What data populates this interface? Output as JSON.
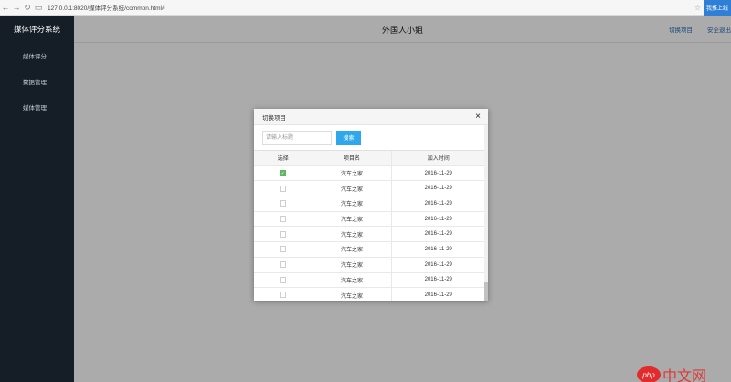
{
  "browser": {
    "url": "127.0.0.1:8020/媒体评分系统/common.html#",
    "badge": "我推上线"
  },
  "sidebar": {
    "brand": "媒体评分系统",
    "items": [
      {
        "label": "媒体评分"
      },
      {
        "label": "数据管理"
      },
      {
        "label": "媒体管理"
      }
    ]
  },
  "header": {
    "title": "外国人小姐",
    "links": [
      {
        "label": "切换项目"
      },
      {
        "label": "安全退出"
      }
    ]
  },
  "modal": {
    "title": "切换项目",
    "close": "×",
    "search_placeholder": "请输入标题",
    "search_button": "搜索",
    "columns": [
      "选择",
      "项目名",
      "加入时间"
    ],
    "rows": [
      {
        "checked": true,
        "name": "汽车之家",
        "date": "2016-11-29"
      },
      {
        "checked": false,
        "name": "汽车之家",
        "date": "2016-11-29"
      },
      {
        "checked": false,
        "name": "汽车之家",
        "date": "2016-11-29"
      },
      {
        "checked": false,
        "name": "汽车之家",
        "date": "2016-11-29"
      },
      {
        "checked": false,
        "name": "汽车之家",
        "date": "2016-11-29"
      },
      {
        "checked": false,
        "name": "汽车之家",
        "date": "2016-11-29"
      },
      {
        "checked": false,
        "name": "汽车之家",
        "date": "2016-11-29"
      },
      {
        "checked": false,
        "name": "汽车之家",
        "date": "2016-11-29"
      },
      {
        "checked": false,
        "name": "汽车之家",
        "date": "2016-11-29"
      }
    ]
  },
  "watermark": {
    "logo": "php",
    "text": "中文网"
  },
  "colors": {
    "sidebar_bg": "#151e27",
    "accent": "#2ea8ea",
    "checked": "#5cb85c",
    "link": "#2a6ebb"
  }
}
